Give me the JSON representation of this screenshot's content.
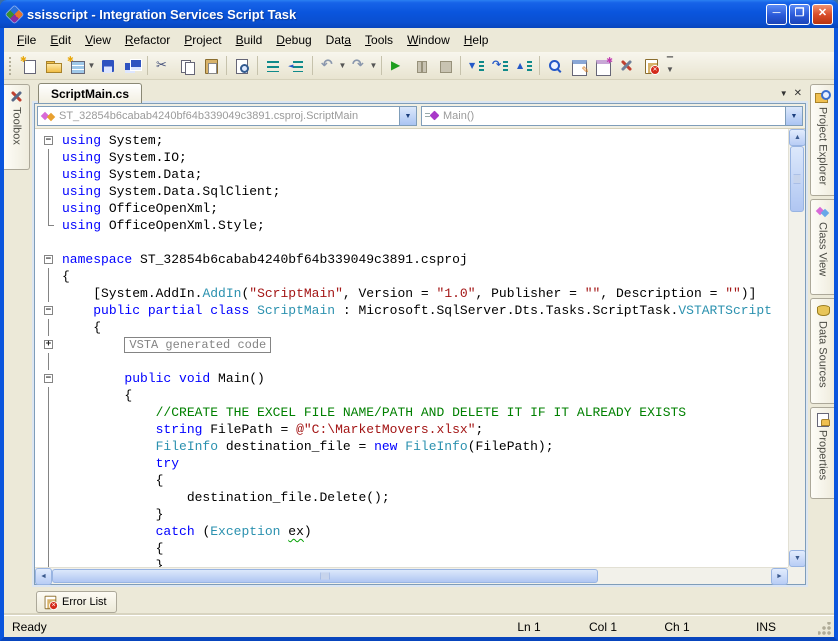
{
  "window": {
    "title": "ssisscript - Integration Services Script Task",
    "controls": {
      "minimize": "─",
      "maximize": "❐",
      "close": "✕"
    }
  },
  "menu": {
    "items": [
      {
        "label": "File",
        "key": 0
      },
      {
        "label": "Edit",
        "key": 0
      },
      {
        "label": "View",
        "key": 0
      },
      {
        "label": "Refactor",
        "key": 0
      },
      {
        "label": "Project",
        "key": 0
      },
      {
        "label": "Build",
        "key": 0
      },
      {
        "label": "Debug",
        "key": 0
      },
      {
        "label": "Data",
        "key": 3
      },
      {
        "label": "Tools",
        "key": 0
      },
      {
        "label": "Window",
        "key": 0
      },
      {
        "label": "Help",
        "key": 0
      }
    ]
  },
  "toolbar": {
    "items": [
      "new-item",
      "open-file",
      "add-item",
      "save",
      "save-all",
      "cut",
      "copy",
      "paste",
      "find-document",
      "comment-lines",
      "uncomment-lines",
      "undo",
      "redo",
      "start-debug",
      "pause",
      "stop",
      "step-into",
      "step-over",
      "step-out",
      "quick-find",
      "properties-window",
      "object-browser",
      "tools",
      "error-list",
      "toolbar-options"
    ]
  },
  "tabs": {
    "document": "ScriptMain.cs",
    "dropdown_glyph": "▼",
    "close_glyph": "✕"
  },
  "navbar": {
    "types_value": "ST_32854b6cabab4240bf64b339049c3891.csproj.ScriptMain",
    "members_value": "Main()"
  },
  "side_left": {
    "tabs": [
      {
        "label": "Toolbox",
        "icon": "toolbox-icon"
      }
    ]
  },
  "side_right": {
    "tabs": [
      {
        "label": "Project Explorer",
        "icon": "project-explorer-icon",
        "h": 112
      },
      {
        "label": "Class View",
        "icon": "class-view-icon",
        "h": 96
      },
      {
        "label": "Data Sources",
        "icon": "data-sources-icon",
        "h": 106
      },
      {
        "label": "Properties",
        "icon": "properties-icon",
        "h": 92
      }
    ]
  },
  "editor": {
    "collapsed_region_label": "VSTA generated code",
    "lines": [
      {
        "fold": "minus",
        "seg": [
          [
            "kw",
            "using"
          ],
          [
            "pl",
            " System;"
          ]
        ]
      },
      {
        "fold": "line",
        "seg": [
          [
            "kw",
            "using"
          ],
          [
            "pl",
            " System.IO;"
          ]
        ]
      },
      {
        "fold": "line",
        "seg": [
          [
            "kw",
            "using"
          ],
          [
            "pl",
            " System.Data;"
          ]
        ]
      },
      {
        "fold": "line",
        "seg": [
          [
            "kw",
            "using"
          ],
          [
            "pl",
            " System.Data.SqlClient;"
          ]
        ]
      },
      {
        "fold": "line",
        "seg": [
          [
            "kw",
            "using"
          ],
          [
            "pl",
            " OfficeOpenXml;"
          ]
        ]
      },
      {
        "fold": "end",
        "seg": [
          [
            "kw",
            "using"
          ],
          [
            "pl",
            " OfficeOpenXml.Style;"
          ]
        ]
      },
      {
        "fold": "none",
        "seg": []
      },
      {
        "fold": "minus",
        "seg": [
          [
            "kw",
            "namespace"
          ],
          [
            "pl",
            " ST_32854b6cabab4240bf64b339049c3891.csproj"
          ]
        ]
      },
      {
        "fold": "line",
        "seg": [
          [
            "pl",
            "{"
          ]
        ]
      },
      {
        "fold": "line",
        "seg": [
          [
            "pl",
            "    [System.AddIn."
          ],
          [
            "ty",
            "AddIn"
          ],
          [
            "pl",
            "("
          ],
          [
            "st",
            "\"ScriptMain\""
          ],
          [
            "pl",
            ", Version = "
          ],
          [
            "st",
            "\"1.0\""
          ],
          [
            "pl",
            ", Publisher = "
          ],
          [
            "st",
            "\"\""
          ],
          [
            "pl",
            ", Description = "
          ],
          [
            "st",
            "\"\""
          ],
          [
            "pl",
            ")]"
          ]
        ]
      },
      {
        "fold": "minus",
        "seg": [
          [
            "pl",
            "    "
          ],
          [
            "kw",
            "public partial class"
          ],
          [
            "pl",
            " "
          ],
          [
            "ty",
            "ScriptMain"
          ],
          [
            "pl",
            " : Microsoft.SqlServer.Dts.Tasks.ScriptTask."
          ],
          [
            "ty",
            "VSTARTScript"
          ]
        ]
      },
      {
        "fold": "line",
        "seg": [
          [
            "pl",
            "    {"
          ]
        ]
      },
      {
        "fold": "plus",
        "seg": [
          [
            "pl",
            "        "
          ],
          [
            "box",
            "VSTA generated code"
          ]
        ]
      },
      {
        "fold": "line",
        "seg": []
      },
      {
        "fold": "minus",
        "seg": [
          [
            "pl",
            "        "
          ],
          [
            "kw",
            "public void"
          ],
          [
            "pl",
            " Main()"
          ]
        ]
      },
      {
        "fold": "line",
        "seg": [
          [
            "pl",
            "        {"
          ]
        ]
      },
      {
        "fold": "line",
        "seg": [
          [
            "pl",
            "            "
          ],
          [
            "cm",
            "//CREATE THE EXCEL FILE NAME/PATH AND DELETE IT IF IT ALREADY EXISTS"
          ]
        ]
      },
      {
        "fold": "line",
        "seg": [
          [
            "pl",
            "            "
          ],
          [
            "kw",
            "string"
          ],
          [
            "pl",
            " FilePath = "
          ],
          [
            "st",
            "@\"C:\\MarketMovers.xlsx\""
          ],
          [
            "pl",
            ";"
          ]
        ]
      },
      {
        "fold": "line",
        "seg": [
          [
            "pl",
            "            "
          ],
          [
            "ty",
            "FileInfo"
          ],
          [
            "pl",
            " destination_file = "
          ],
          [
            "kw",
            "new"
          ],
          [
            "pl",
            " "
          ],
          [
            "ty",
            "FileInfo"
          ],
          [
            "pl",
            "(FilePath);"
          ]
        ]
      },
      {
        "fold": "line",
        "seg": [
          [
            "pl",
            "            "
          ],
          [
            "kw",
            "try"
          ]
        ]
      },
      {
        "fold": "line",
        "seg": [
          [
            "pl",
            "            {"
          ]
        ]
      },
      {
        "fold": "line",
        "seg": [
          [
            "pl",
            "                destination_file.Delete();"
          ]
        ]
      },
      {
        "fold": "line",
        "seg": [
          [
            "pl",
            "            }"
          ]
        ]
      },
      {
        "fold": "line",
        "seg": [
          [
            "pl",
            "            "
          ],
          [
            "kw",
            "catch"
          ],
          [
            "pl",
            " ("
          ],
          [
            "ty",
            "Exception"
          ],
          [
            "pl",
            " "
          ],
          [
            "sq",
            "ex"
          ],
          [
            "pl",
            ")"
          ]
        ]
      },
      {
        "fold": "line",
        "seg": [
          [
            "pl",
            "            {"
          ]
        ]
      },
      {
        "fold": "line",
        "seg": [
          [
            "pl",
            "            }"
          ]
        ]
      }
    ],
    "syntax_colors": {
      "keyword": "#0000ff",
      "type": "#2b91af",
      "string": "#a31515",
      "comment": "#008000",
      "plain": "#000000"
    }
  },
  "bottom": {
    "error_list_label": "Error List"
  },
  "status": {
    "ready": "Ready",
    "ln": "Ln 1",
    "col": "Col 1",
    "ch": "Ch 1",
    "ins": "INS"
  },
  "colors": {
    "titlebar_blue": "#0a55dd",
    "chrome_tan": "#ece9d8",
    "editor_border": "#7f9db9"
  }
}
